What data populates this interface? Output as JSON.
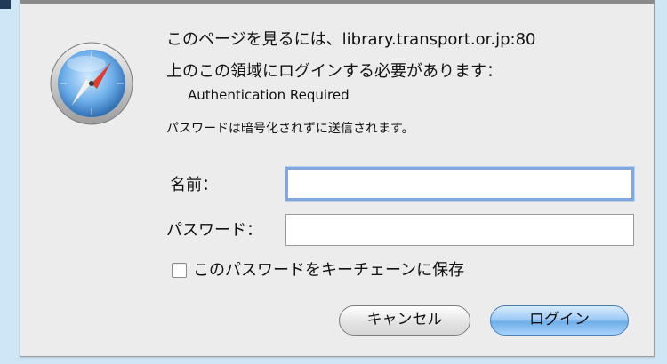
{
  "dialog": {
    "message_line1": "このページを見るには、library.transport.or.jp:80",
    "message_line2": "上のこの領域にログインする必要があります：",
    "realm": "Authentication Required",
    "warning": "パスワードは暗号化されずに送信されます。"
  },
  "form": {
    "name_label": "名前：",
    "name_value": "",
    "password_label": "パスワード：",
    "password_value": "",
    "remember_label": "このパスワードをキーチェーンに保存",
    "remember_checked": false
  },
  "buttons": {
    "cancel_label": "キャンセル",
    "login_label": "ログイン"
  },
  "icons": {
    "app_icon": "safari-compass-icon"
  },
  "colors": {
    "page_background": "#cfe6f6",
    "dialog_background": "#ececec",
    "focus_ring": "#7fa9de",
    "default_button": "#6eaee9"
  }
}
